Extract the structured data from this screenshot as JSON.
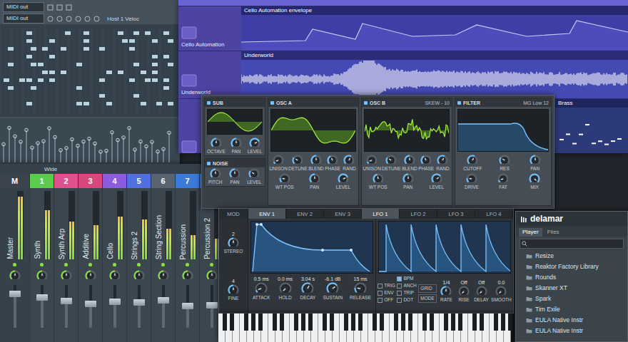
{
  "channel_rack": {
    "output": "MIDI out",
    "output2": "MIDI out",
    "control": "Host 1 Veloc"
  },
  "playlist": {
    "tracks": [
      {
        "name": "Cello Automation",
        "clip": "Cello Automation envelope",
        "kind": "automation"
      },
      {
        "name": "Underworld",
        "clip": "Underworld",
        "kind": "audio"
      },
      {
        "clip": "Brass",
        "kind": "pattern"
      }
    ]
  },
  "mixer": {
    "preset": "Wide",
    "channels": [
      {
        "number": "M",
        "name": "Master",
        "color": "#3b444d",
        "meter": 0.92,
        "pan": 0.5,
        "level": 0.78
      },
      {
        "number": "1",
        "name": "Synth",
        "color": "#5ccc4e",
        "meter": 0.72,
        "pan": 0.5,
        "level": 0.7
      },
      {
        "number": "2",
        "name": "Synth Arp",
        "color": "#e0508e",
        "meter": 0.55,
        "pan": 0.5,
        "level": 0.62
      },
      {
        "number": "3",
        "name": "Additive",
        "color": "#d9487c",
        "meter": 0.5,
        "pan": 0.5,
        "level": 0.55
      },
      {
        "number": "4",
        "name": "Cello",
        "color": "#8c5ce0",
        "meter": 0.62,
        "pan": 0.5,
        "level": 0.6
      },
      {
        "number": "5",
        "name": "Strings 2",
        "color": "#4f70de",
        "meter": 0.58,
        "pan": 0.5,
        "level": 0.58
      },
      {
        "number": "6",
        "name": "String Section",
        "color": "#5a6470",
        "meter": 0.45,
        "pan": 0.5,
        "level": 0.64
      },
      {
        "number": "7",
        "name": "Percussion",
        "color": "#3c7ad8",
        "meter": 0.35,
        "pan": 0.5,
        "level": 0.5
      },
      {
        "name": "Percussion 2",
        "color": "#3c7ad8",
        "meter": 0.3,
        "pan": 0.5,
        "level": 0.52
      }
    ]
  },
  "synth": {
    "panels": [
      {
        "title": "SUB",
        "kind": "small",
        "knobs": [
          {
            "label": "OCTAVE",
            "level": 0.5
          },
          {
            "label": "PAN",
            "level": 0.5
          },
          {
            "label": "LEVEL",
            "level": 0.75
          }
        ]
      },
      {
        "title": "NOISE",
        "kind": "small",
        "knobs": [
          {
            "label": "PITCH",
            "level": 0.5
          },
          {
            "label": "PAN",
            "level": 0.5
          },
          {
            "label": "LEVEL",
            "level": 0.3
          }
        ]
      },
      {
        "title": "OSC A",
        "kind": "smooth",
        "knobs": [
          {
            "label": "UNISON",
            "level": 0.1
          },
          {
            "label": "DETUNE",
            "level": 0.3
          },
          {
            "label": "BLEND",
            "level": 0.5
          },
          {
            "label": "PHASE",
            "level": 0.4
          },
          {
            "label": "RAND",
            "level": 0.6
          },
          {
            "label": "WT POS",
            "level": 0.2
          },
          {
            "label": "PAN",
            "level": 0.5
          },
          {
            "label": "LEVEL",
            "level": 0.75
          }
        ]
      },
      {
        "title": "OSC B",
        "subtitle": "SKEW - 10",
        "kind": "jagged",
        "knobs": [
          {
            "label": "UNISON",
            "level": 0.1
          },
          {
            "label": "DETUNE",
            "level": 0.3
          },
          {
            "label": "BLEND",
            "level": 0.5
          },
          {
            "label": "PHASE",
            "level": 0.4
          },
          {
            "label": "RAND",
            "level": 0.6
          },
          {
            "label": "WT POS",
            "level": 0.45
          },
          {
            "label": "PAN",
            "level": 0.5
          },
          {
            "label": "LEVEL",
            "level": 0.7
          }
        ]
      },
      {
        "title": "FILTER",
        "subtitle": "MG Low 12",
        "kind": "filter",
        "knobs": [
          {
            "label": "CUTOFF",
            "level": 0.6
          },
          {
            "label": "RES",
            "level": 0.3
          },
          {
            "label": "PAN",
            "level": 0.5
          },
          {
            "label": "DRIVE",
            "level": 0.2
          },
          {
            "label": "FAT",
            "level": 0.1
          },
          {
            "label": "MIX",
            "level": 1
          }
        ]
      }
    ]
  },
  "modulation": {
    "tabs": [
      {
        "label": "MOD",
        "selected": false
      },
      {
        "label": "ENV 1",
        "selected": true
      },
      {
        "label": "ENV 2",
        "selected": false
      },
      {
        "label": "ENV 3",
        "selected": false
      },
      {
        "label": "LFO 1",
        "selected": true
      },
      {
        "label": "LFO 2",
        "selected": false
      },
      {
        "label": "LFO 3",
        "selected": false
      },
      {
        "label": "LFO 4",
        "selected": false
      }
    ],
    "side": [
      {
        "value": "2",
        "label": "STEREO",
        "level": 0.5
      },
      {
        "value": "4",
        "label": "FINE",
        "level": 0.5
      }
    ],
    "envelope": {
      "knobs": [
        {
          "value": "0.5 ms",
          "label": "ATTACK",
          "level": 0.1
        },
        {
          "value": "0.0 ms",
          "label": "HOLD",
          "level": 0
        },
        {
          "value": "3.04 s",
          "label": "DECAY",
          "level": 0.6
        },
        {
          "value": "-6.1 dB",
          "label": "SUSTAIN",
          "level": 0.7
        },
        {
          "value": "15 ms",
          "label": "RELEASE",
          "level": 0.2
        }
      ]
    },
    "lfo": {
      "switches": [
        {
          "label": "TRIG",
          "on": false
        },
        {
          "label": "ENV",
          "on": false
        },
        {
          "label": "OFF",
          "on": false
        }
      ],
      "modes": [
        {
          "label": "BPM",
          "on": true
        },
        {
          "label": "ANCH",
          "on": false
        },
        {
          "label": "TRIP",
          "on": false
        },
        {
          "label": "DOT",
          "on": false
        }
      ],
      "buttons": [
        "GRID",
        "MODE"
      ],
      "knobs": [
        {
          "value": "1/4",
          "label": "RATE",
          "level": 0.5
        },
        {
          "value": "Off",
          "label": "RISE",
          "level": 0
        },
        {
          "value": "Off",
          "label": "DELAY",
          "level": 0
        },
        {
          "value": "0.0",
          "label": "SMOOTH",
          "level": 0
        }
      ]
    }
  },
  "browser": {
    "logo": "delamar",
    "tabs": [
      {
        "label": "Player",
        "selected": true
      },
      {
        "label": "Files",
        "selected": false
      }
    ],
    "items": [
      "Resize",
      "Reaktor Factory Library",
      "Rounds",
      "Skanner XT",
      "Spark",
      "Tim Exile",
      "EULA Native Instr",
      "EULA Native Instr"
    ]
  }
}
